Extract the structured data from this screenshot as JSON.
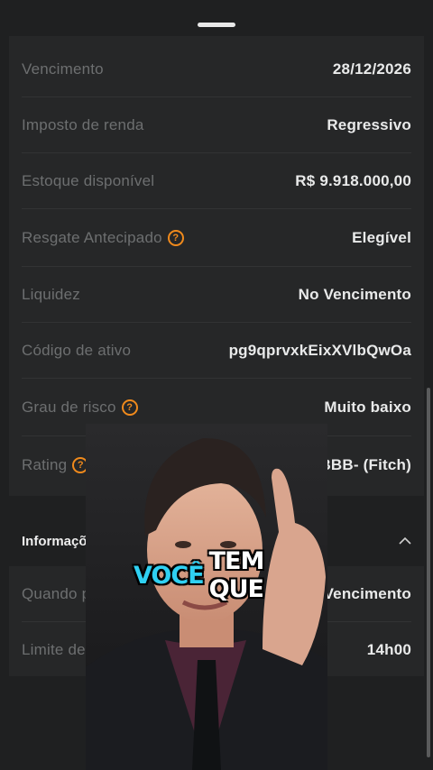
{
  "details": [
    {
      "label": "Vencimento",
      "value": "28/12/2026",
      "help": false
    },
    {
      "label": "Imposto de renda",
      "value": "Regressivo",
      "help": false
    },
    {
      "label": "Estoque disponível",
      "value": "R$ 9.918.000,00",
      "help": false
    },
    {
      "label": "Resgate Antecipado",
      "value": "Elegível",
      "help": true
    },
    {
      "label": "Liquidez",
      "value": "No Vencimento",
      "help": false
    },
    {
      "label": "Código de ativo",
      "value": "pg9qprvxkEixXVlbQwOa",
      "help": false
    },
    {
      "label": "Grau de risco",
      "value": "Muito baixo",
      "help": true
    },
    {
      "label": "Rating",
      "value": "BBB- (Fitch)",
      "help": true
    }
  ],
  "info_section": {
    "title": "Informaçõe",
    "rows": [
      {
        "label": "Quando po",
        "value": "No Vencimento"
      },
      {
        "label": "Limite de",
        "value": "14h00"
      }
    ]
  },
  "caption": {
    "highlight": "VOCÊ",
    "rest": "TEM QUE"
  },
  "help_glyph": "?",
  "colors": {
    "accent": "#f08a1c",
    "caption_highlight": "#2fd0f2",
    "background": "#1f2021"
  }
}
